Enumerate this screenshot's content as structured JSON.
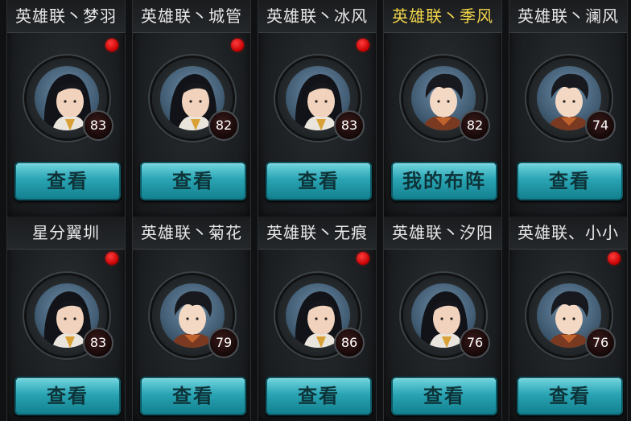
{
  "row1": [
    {
      "name": "英雄联丶梦羽",
      "level": "83",
      "button": "查看",
      "alert": true,
      "self": false,
      "avatar": "female-hero-icon"
    },
    {
      "name": "英雄联丶城管",
      "level": "82",
      "button": "查看",
      "alert": true,
      "self": false,
      "avatar": "female-hero-icon"
    },
    {
      "name": "英雄联丶冰风",
      "level": "83",
      "button": "查看",
      "alert": true,
      "self": false,
      "avatar": "female-hero-icon"
    },
    {
      "name": "英雄联丶季风",
      "level": "82",
      "button": "我的布阵",
      "alert": false,
      "self": true,
      "avatar": "male-hero-icon"
    },
    {
      "name": "英雄联丶澜风",
      "level": "74",
      "button": "查看",
      "alert": false,
      "self": false,
      "avatar": "male-hero-icon"
    }
  ],
  "row2": [
    {
      "name": "星分翼圳",
      "level": "83",
      "button": "查看",
      "alert": true,
      "self": false,
      "avatar": "female-hero-icon"
    },
    {
      "name": "英雄联丶菊花",
      "level": "79",
      "button": "查看",
      "alert": false,
      "self": false,
      "avatar": "male-hero-icon"
    },
    {
      "name": "英雄联丶无痕",
      "level": "86",
      "button": "查看",
      "alert": true,
      "self": false,
      "avatar": "female-hero-icon"
    },
    {
      "name": "英雄联丶汐阳",
      "level": "76",
      "button": "查看",
      "alert": false,
      "self": false,
      "avatar": "female-hero-icon"
    },
    {
      "name": "英雄联、小小",
      "level": "76",
      "button": "查看",
      "alert": true,
      "self": false,
      "avatar": "male-hero-icon"
    }
  ],
  "colors": {
    "self_name": "#f2d64a",
    "name": "#e8e8e8",
    "button": "#2aa4b3",
    "alert_dot": "#e00000"
  }
}
